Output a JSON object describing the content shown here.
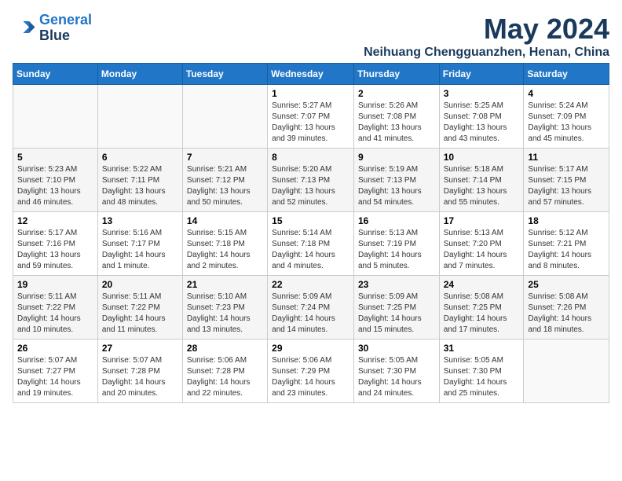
{
  "header": {
    "logo_line1": "General",
    "logo_line2": "Blue",
    "month": "May 2024",
    "location": "Neihuang Chengguanzhen, Henan, China"
  },
  "days_of_week": [
    "Sunday",
    "Monday",
    "Tuesday",
    "Wednesday",
    "Thursday",
    "Friday",
    "Saturday"
  ],
  "weeks": [
    [
      {
        "day": "",
        "info": ""
      },
      {
        "day": "",
        "info": ""
      },
      {
        "day": "",
        "info": ""
      },
      {
        "day": "1",
        "info": "Sunrise: 5:27 AM\nSunset: 7:07 PM\nDaylight: 13 hours and 39 minutes."
      },
      {
        "day": "2",
        "info": "Sunrise: 5:26 AM\nSunset: 7:08 PM\nDaylight: 13 hours and 41 minutes."
      },
      {
        "day": "3",
        "info": "Sunrise: 5:25 AM\nSunset: 7:08 PM\nDaylight: 13 hours and 43 minutes."
      },
      {
        "day": "4",
        "info": "Sunrise: 5:24 AM\nSunset: 7:09 PM\nDaylight: 13 hours and 45 minutes."
      }
    ],
    [
      {
        "day": "5",
        "info": "Sunrise: 5:23 AM\nSunset: 7:10 PM\nDaylight: 13 hours and 46 minutes."
      },
      {
        "day": "6",
        "info": "Sunrise: 5:22 AM\nSunset: 7:11 PM\nDaylight: 13 hours and 48 minutes."
      },
      {
        "day": "7",
        "info": "Sunrise: 5:21 AM\nSunset: 7:12 PM\nDaylight: 13 hours and 50 minutes."
      },
      {
        "day": "8",
        "info": "Sunrise: 5:20 AM\nSunset: 7:13 PM\nDaylight: 13 hours and 52 minutes."
      },
      {
        "day": "9",
        "info": "Sunrise: 5:19 AM\nSunset: 7:13 PM\nDaylight: 13 hours and 54 minutes."
      },
      {
        "day": "10",
        "info": "Sunrise: 5:18 AM\nSunset: 7:14 PM\nDaylight: 13 hours and 55 minutes."
      },
      {
        "day": "11",
        "info": "Sunrise: 5:17 AM\nSunset: 7:15 PM\nDaylight: 13 hours and 57 minutes."
      }
    ],
    [
      {
        "day": "12",
        "info": "Sunrise: 5:17 AM\nSunset: 7:16 PM\nDaylight: 13 hours and 59 minutes."
      },
      {
        "day": "13",
        "info": "Sunrise: 5:16 AM\nSunset: 7:17 PM\nDaylight: 14 hours and 1 minute."
      },
      {
        "day": "14",
        "info": "Sunrise: 5:15 AM\nSunset: 7:18 PM\nDaylight: 14 hours and 2 minutes."
      },
      {
        "day": "15",
        "info": "Sunrise: 5:14 AM\nSunset: 7:18 PM\nDaylight: 14 hours and 4 minutes."
      },
      {
        "day": "16",
        "info": "Sunrise: 5:13 AM\nSunset: 7:19 PM\nDaylight: 14 hours and 5 minutes."
      },
      {
        "day": "17",
        "info": "Sunrise: 5:13 AM\nSunset: 7:20 PM\nDaylight: 14 hours and 7 minutes."
      },
      {
        "day": "18",
        "info": "Sunrise: 5:12 AM\nSunset: 7:21 PM\nDaylight: 14 hours and 8 minutes."
      }
    ],
    [
      {
        "day": "19",
        "info": "Sunrise: 5:11 AM\nSunset: 7:22 PM\nDaylight: 14 hours and 10 minutes."
      },
      {
        "day": "20",
        "info": "Sunrise: 5:11 AM\nSunset: 7:22 PM\nDaylight: 14 hours and 11 minutes."
      },
      {
        "day": "21",
        "info": "Sunrise: 5:10 AM\nSunset: 7:23 PM\nDaylight: 14 hours and 13 minutes."
      },
      {
        "day": "22",
        "info": "Sunrise: 5:09 AM\nSunset: 7:24 PM\nDaylight: 14 hours and 14 minutes."
      },
      {
        "day": "23",
        "info": "Sunrise: 5:09 AM\nSunset: 7:25 PM\nDaylight: 14 hours and 15 minutes."
      },
      {
        "day": "24",
        "info": "Sunrise: 5:08 AM\nSunset: 7:25 PM\nDaylight: 14 hours and 17 minutes."
      },
      {
        "day": "25",
        "info": "Sunrise: 5:08 AM\nSunset: 7:26 PM\nDaylight: 14 hours and 18 minutes."
      }
    ],
    [
      {
        "day": "26",
        "info": "Sunrise: 5:07 AM\nSunset: 7:27 PM\nDaylight: 14 hours and 19 minutes."
      },
      {
        "day": "27",
        "info": "Sunrise: 5:07 AM\nSunset: 7:28 PM\nDaylight: 14 hours and 20 minutes."
      },
      {
        "day": "28",
        "info": "Sunrise: 5:06 AM\nSunset: 7:28 PM\nDaylight: 14 hours and 22 minutes."
      },
      {
        "day": "29",
        "info": "Sunrise: 5:06 AM\nSunset: 7:29 PM\nDaylight: 14 hours and 23 minutes."
      },
      {
        "day": "30",
        "info": "Sunrise: 5:05 AM\nSunset: 7:30 PM\nDaylight: 14 hours and 24 minutes."
      },
      {
        "day": "31",
        "info": "Sunrise: 5:05 AM\nSunset: 7:30 PM\nDaylight: 14 hours and 25 minutes."
      },
      {
        "day": "",
        "info": ""
      }
    ]
  ]
}
